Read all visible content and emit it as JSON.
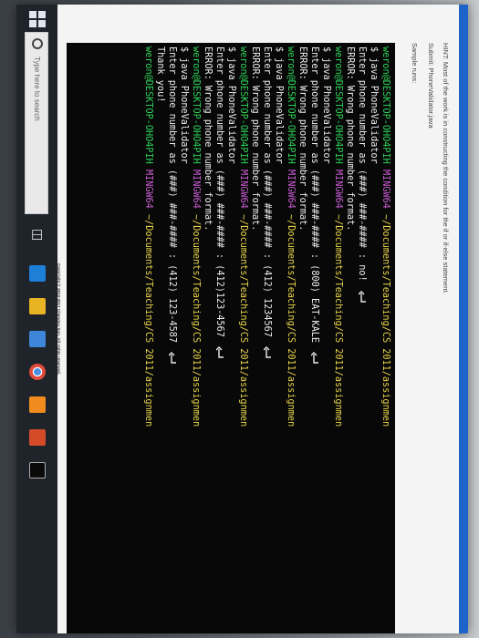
{
  "hints": {
    "hint_line": "HINT: Most of the work is in constructing the condition for the if or if-else statement.",
    "submit_line": "Submit: PhoneValidator.java",
    "sample_line": "Sample runs:"
  },
  "terminal": {
    "prompt_user": "weron@DESKTOP-OHO4PIH",
    "prompt_system": "MINGW64",
    "prompt_path": "~/Documents/Teaching/CS 2011/assignmen",
    "command": "$ java PhoneValidator",
    "input_prefix": "Enter phone number as (###) ###-#### : ",
    "runs": [
      {
        "input": "no!",
        "response": "ERROR: Wrong phone number format."
      },
      {
        "input": "(800) EAT-KALE",
        "response": "ERROR: Wrong phone number format."
      },
      {
        "input": "(412) 1234567",
        "response": "ERROR: Wrong phone number format."
      },
      {
        "input": "(412)123-4567",
        "response": "ERROR: Wrong phone number format."
      },
      {
        "input": "(412) 123-4587",
        "response": "Thank you!"
      }
    ]
  },
  "copyright": "Copyright © 2012-2017 Chengyu Sun. All rights reserved.",
  "taskbar": {
    "search_placeholder": "Type here to search",
    "icons": [
      "start-icon",
      "task-view-icon",
      "edge-icon",
      "file-explorer-icon",
      "store-icon",
      "chrome-icon",
      "sublime-icon",
      "java-icon",
      "terminal-icon"
    ]
  },
  "colors": {
    "prompt_user": "#2ed158",
    "prompt_system": "#c75cd1",
    "prompt_path": "#e9d54b",
    "terminal_bg": "#080808",
    "taskbar_bg": "#1f242b",
    "window_bar": "#1d63c9"
  }
}
